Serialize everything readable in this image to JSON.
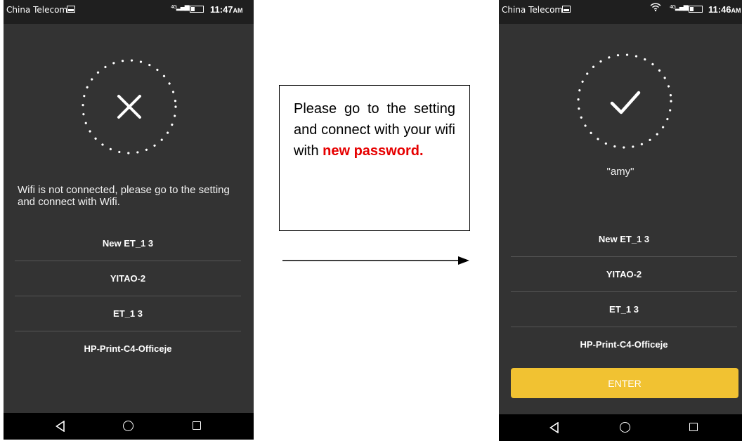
{
  "left_phone": {
    "status": {
      "carrier": "China Telecom",
      "network": "4G",
      "time": "11:47",
      "ampm": "AM"
    },
    "result_icon": "close-icon",
    "message": "Wifi is not connected, please go to the setting and connect with Wifi.",
    "networks": [
      "New ET_1 3",
      "YITAO-2",
      "ET_1 3",
      "HP-Print-C4-Officeje"
    ]
  },
  "note": {
    "text": "Please go to the setting and connect with your wifi with",
    "emphasis": "new password.",
    "emphasis_color": "#e60000"
  },
  "right_phone": {
    "status": {
      "carrier": "China Telecom",
      "network": "4G",
      "time": "11:46",
      "ampm": "AM"
    },
    "result_icon": "checkmark-icon",
    "ssid": "\"amy\"",
    "networks": [
      "New ET_1 3",
      "YITAO-2",
      "ET_1 3",
      "HP-Print-C4-Officeje"
    ],
    "enter_label": "ENTER",
    "enter_color": "#f1c232"
  }
}
